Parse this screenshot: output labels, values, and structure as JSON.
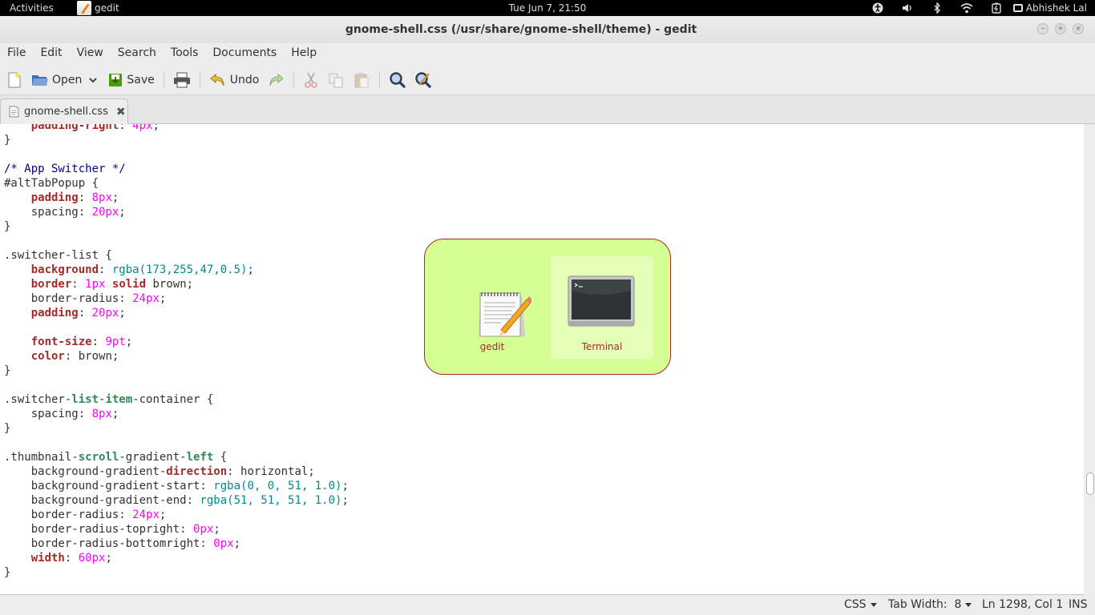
{
  "topbar": {
    "activities": "Activities",
    "app_name": "gedit",
    "clock": "Tue Jun  7, 21:50",
    "user": "Abhishek Lal",
    "icons": [
      "accessibility-icon",
      "volume-icon",
      "bluetooth-icon",
      "wifi-icon",
      "battery-icon",
      "user-icon"
    ]
  },
  "window": {
    "title": "gnome-shell.css (/usr/share/gnome-shell/theme) - gedit"
  },
  "menubar": {
    "items": [
      "File",
      "Edit",
      "View",
      "Search",
      "Tools",
      "Documents",
      "Help"
    ]
  },
  "toolbar": {
    "open_label": "Open",
    "save_label": "Save",
    "undo_label": "Undo"
  },
  "tabs": [
    {
      "label": "gnome-shell.css"
    }
  ],
  "code_lines": [
    [
      [
        "    ",
        ""
      ],
      [
        "padding-right",
        "k"
      ],
      [
        ": ",
        ""
      ],
      [
        "4px",
        "n"
      ],
      [
        ";",
        ""
      ]
    ],
    [
      [
        "}",
        ""
      ]
    ],
    [
      [
        "",
        ""
      ]
    ],
    [
      [
        "/* App Switcher */",
        "c"
      ]
    ],
    [
      [
        "#altTabPopup {",
        ""
      ]
    ],
    [
      [
        "    ",
        ""
      ],
      [
        "padding",
        "k"
      ],
      [
        ": ",
        ""
      ],
      [
        "8px",
        "n"
      ],
      [
        ";",
        ""
      ]
    ],
    [
      [
        "    spacing: ",
        ""
      ],
      [
        "20px",
        "n"
      ],
      [
        ";",
        ""
      ]
    ],
    [
      [
        "}",
        ""
      ]
    ],
    [
      [
        "",
        ""
      ]
    ],
    [
      [
        ".switcher-list {",
        ""
      ]
    ],
    [
      [
        "    ",
        ""
      ],
      [
        "background",
        "k"
      ],
      [
        ": ",
        ""
      ],
      [
        "rgba(173,255,47,0.5)",
        "f"
      ],
      [
        ";",
        ""
      ]
    ],
    [
      [
        "    ",
        ""
      ],
      [
        "border",
        "k"
      ],
      [
        ": ",
        ""
      ],
      [
        "1px",
        "n"
      ],
      [
        " ",
        ""
      ],
      [
        "solid",
        "k"
      ],
      [
        " brown;",
        ""
      ]
    ],
    [
      [
        "    border-radius: ",
        ""
      ],
      [
        "24px",
        "n"
      ],
      [
        ";",
        ""
      ]
    ],
    [
      [
        "    ",
        ""
      ],
      [
        "padding",
        "k"
      ],
      [
        ": ",
        ""
      ],
      [
        "20px",
        "n"
      ],
      [
        ";",
        ""
      ]
    ],
    [
      [
        "",
        ""
      ]
    ],
    [
      [
        "    ",
        ""
      ],
      [
        "font-size",
        "k"
      ],
      [
        ": ",
        ""
      ],
      [
        "9pt",
        "n"
      ],
      [
        ";",
        ""
      ]
    ],
    [
      [
        "    ",
        ""
      ],
      [
        "color",
        "k"
      ],
      [
        ": brown;",
        ""
      ]
    ],
    [
      [
        "}",
        ""
      ]
    ],
    [
      [
        "",
        ""
      ]
    ],
    [
      [
        ".switcher-",
        ""
      ],
      [
        "list",
        "g"
      ],
      [
        "-",
        ""
      ],
      [
        "item",
        "g"
      ],
      [
        "-container {",
        ""
      ]
    ],
    [
      [
        "    spacing: ",
        ""
      ],
      [
        "8px",
        "n"
      ],
      [
        ";",
        ""
      ]
    ],
    [
      [
        "}",
        ""
      ]
    ],
    [
      [
        "",
        ""
      ]
    ],
    [
      [
        ".thumbnail-",
        ""
      ],
      [
        "scroll",
        "g"
      ],
      [
        "-gradient-",
        ""
      ],
      [
        "left",
        "g"
      ],
      [
        " {",
        ""
      ]
    ],
    [
      [
        "    background-gradient-",
        ""
      ],
      [
        "direction",
        "k"
      ],
      [
        ": horizontal;",
        ""
      ]
    ],
    [
      [
        "    background-gradient-start: ",
        ""
      ],
      [
        "rgba(0, 0, 51, 1.0)",
        "f"
      ],
      [
        ";",
        ""
      ]
    ],
    [
      [
        "    background-gradient-end: ",
        ""
      ],
      [
        "rgba(51, 51, 51, 1.0)",
        "f"
      ],
      [
        ";",
        ""
      ]
    ],
    [
      [
        "    border-radius: ",
        ""
      ],
      [
        "24px",
        "n"
      ],
      [
        ";",
        ""
      ]
    ],
    [
      [
        "    border-radius-topright: ",
        ""
      ],
      [
        "0px",
        "n"
      ],
      [
        ";",
        ""
      ]
    ],
    [
      [
        "    border-radius-bottomright: ",
        ""
      ],
      [
        "0px",
        "n"
      ],
      [
        ";",
        ""
      ]
    ],
    [
      [
        "    ",
        ""
      ],
      [
        "width",
        "k"
      ],
      [
        ": ",
        ""
      ],
      [
        "60px",
        "n"
      ],
      [
        ";",
        ""
      ]
    ],
    [
      [
        "}",
        ""
      ]
    ]
  ],
  "switcher": {
    "items": [
      {
        "label": "gedit",
        "icon": "text-editor-icon",
        "selected": false
      },
      {
        "label": "Terminal",
        "icon": "terminal-icon",
        "selected": true
      }
    ]
  },
  "statusbar": {
    "language": "CSS",
    "tab_width": "Tab Width:  8",
    "position": "Ln 1298, Col 1",
    "mode": "INS"
  }
}
